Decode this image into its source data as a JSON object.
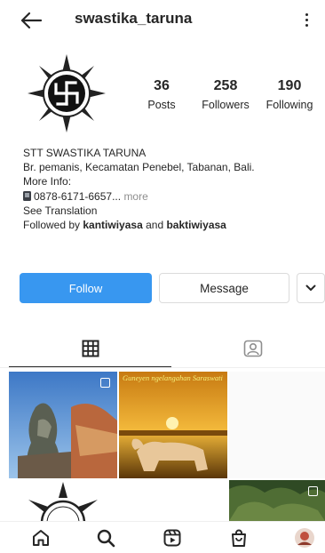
{
  "header": {
    "username": "swastika_taruna",
    "back_icon": "arrow-left-icon",
    "menu_icon": "vertical-dots-icon"
  },
  "profile": {
    "avatar_icon": "swastika-emblem-logo",
    "stats": [
      {
        "value": "36",
        "label": "Posts"
      },
      {
        "value": "258",
        "label": "Followers"
      },
      {
        "value": "190",
        "label": "Following"
      }
    ],
    "bio": {
      "name": "STT SWASTIKA TARUNA",
      "address": "Br. pemanis, Kecamatan Penebel, Tabanan, Bali.",
      "more_info": "More Info:",
      "phone": "0878-6171-6657...",
      "more_link": "more",
      "see_translation": "See Translation",
      "followed_by_prefix": "Followed by",
      "followed_user_1": "kantiwiyasa",
      "followed_and": "and",
      "followed_user_2": "baktiwiyasa"
    }
  },
  "actions": {
    "follow_label": "Follow",
    "message_label": "Message",
    "suggest_icon": "chevron-down-icon"
  },
  "tabs": [
    {
      "name": "grid",
      "icon": "grid-icon",
      "active": true
    },
    {
      "name": "tagged",
      "icon": "tagged-user-icon",
      "active": false
    }
  ],
  "posts": [
    {
      "id": "post-1",
      "description_icon": "multiple-photos-icon"
    },
    {
      "id": "post-2",
      "caption": "Guneyen ngelangahan Saraswati"
    },
    {
      "id": "post-3"
    },
    {
      "id": "post-4"
    },
    {
      "id": "post-6"
    }
  ],
  "bottom_nav": [
    {
      "name": "home",
      "icon": "home-icon"
    },
    {
      "name": "search",
      "icon": "search-icon"
    },
    {
      "name": "reels",
      "icon": "reels-icon"
    },
    {
      "name": "shop",
      "icon": "shop-bag-icon"
    },
    {
      "name": "profile",
      "icon": "profile-avatar"
    }
  ],
  "colors": {
    "accent": "#3897f0",
    "text": "#262626",
    "muted": "#8e8e8e",
    "border": "#dbdbdb"
  }
}
